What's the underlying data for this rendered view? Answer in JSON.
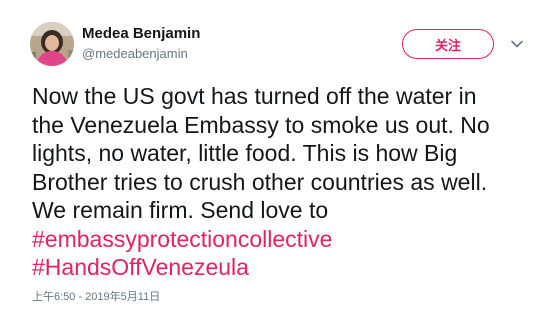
{
  "author": {
    "display_name": "Medea Benjamin",
    "handle": "@medeabenjamin"
  },
  "actions": {
    "follow_label": "关注",
    "more_icon": "chevron-down-icon"
  },
  "tweet": {
    "lines": [
      "Now the US govt has turned off the water in",
      "the Venezuela Embassy to smoke us out. No",
      "lights, no water, little food. This is how Big",
      "Brother tries to crush other countries as well.",
      "We remain firm. Send love to"
    ],
    "hashtags": [
      "#embassyprotectioncollective",
      "#HandsOffVenezeula"
    ],
    "timestamp": "上午6:50 - 2019年5月11日"
  },
  "colors": {
    "accent": "#e0245e",
    "text": "#14171a",
    "muted": "#657786"
  }
}
